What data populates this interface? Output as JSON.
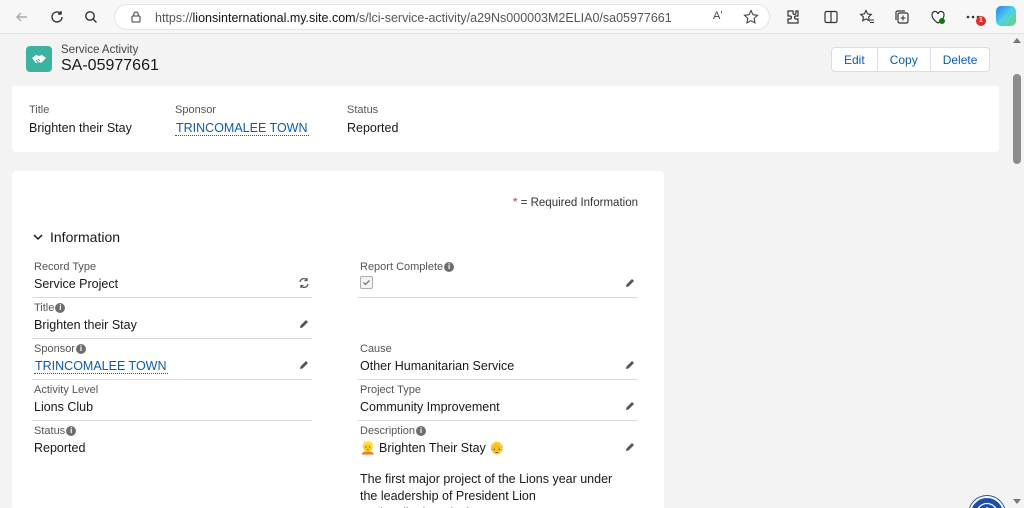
{
  "browser": {
    "url_prefix": "https://",
    "url_host": "lionsinternational.my.site.com",
    "url_path": "/s/lci-service-activity/a29Ns000003M2ELIA0/sa05977661",
    "read_aloud_label": "Aʹ",
    "notification_count": "1"
  },
  "record": {
    "object_type": "Service Activity",
    "name": "SA-05977661",
    "actions": {
      "edit": "Edit",
      "copy": "Copy",
      "delete": "Delete"
    }
  },
  "highlights": {
    "title_label": "Title",
    "title_value": "Brighten their Stay",
    "sponsor_label": "Sponsor",
    "sponsor_value": "TRINCOMALEE TOWN",
    "status_label": "Status",
    "status_value": "Reported"
  },
  "details": {
    "required_asterisk": "*",
    "required_text": "= Required Information",
    "section_title": "Information",
    "record_type_label": "Record Type",
    "record_type_value": "Service Project",
    "report_complete_label": "Report Complete",
    "report_complete_checked": true,
    "title_label": "Title",
    "title_value": "Brighten their Stay",
    "sponsor_label": "Sponsor",
    "sponsor_value": "TRINCOMALEE TOWN",
    "cause_label": "Cause",
    "cause_value": "Other Humanitarian Service",
    "activity_level_label": "Activity Level",
    "activity_level_value": "Lions Club",
    "project_type_label": "Project Type",
    "project_type_value": "Community Improvement",
    "status_label": "Status",
    "status_value": "Reported",
    "description_label": "Description",
    "description_heading": "👱 Brighten Their Stay 👴",
    "description_body": "The first major project of the Lions year under the leadership of President Lion Nadesalingham is the"
  },
  "icons": {
    "info": "i",
    "object": "handshake-icon",
    "accessibility": "accessibility-icon"
  },
  "colors": {
    "link": "#0b5cab",
    "object_icon": "#3bb3a0",
    "accessibility_button": "#1f4ea8"
  }
}
